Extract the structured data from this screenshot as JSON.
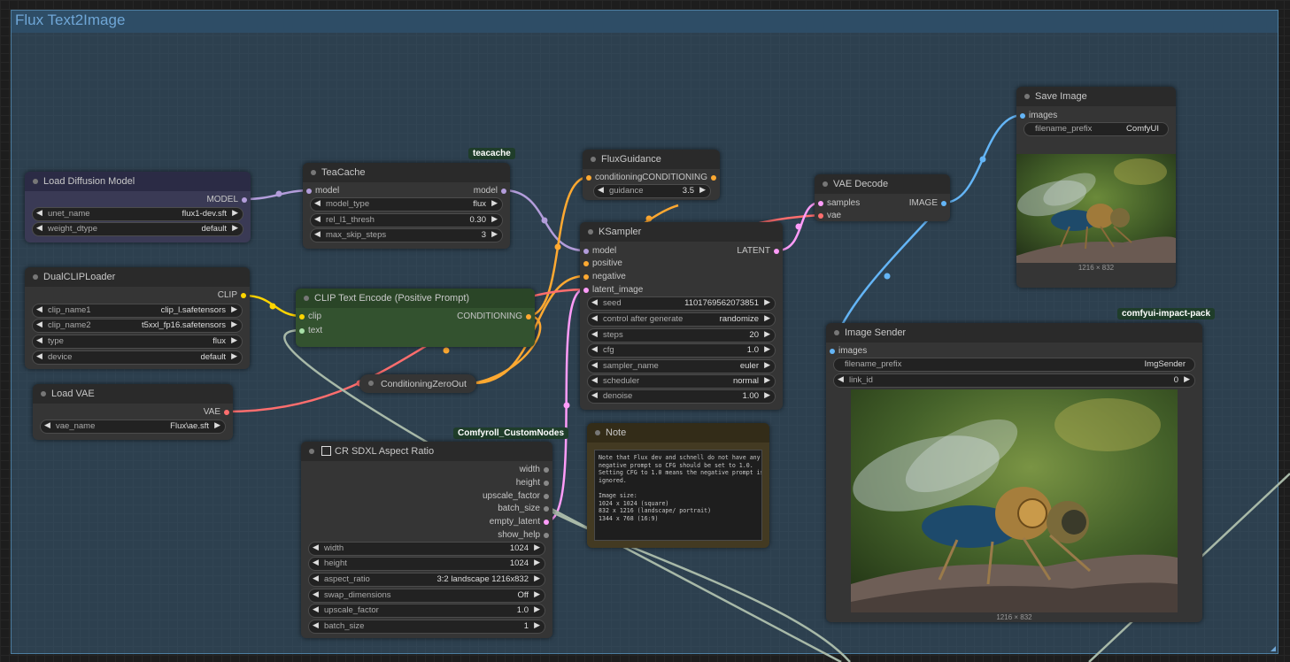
{
  "group": {
    "title": "Flux Text2Image"
  },
  "colors": {
    "model": "#b39ddb",
    "clip": "#ffd500",
    "conditioning": "#ffa931",
    "latent": "#ff9cf9",
    "vae": "#ff6e6e",
    "image": "#64b5f6",
    "text": "#a8b9a8"
  },
  "badges": {
    "teacache": "teacache",
    "comfyroll": "Comfyroll_CustomNodes",
    "impact": "comfyui-impact-pack"
  },
  "load_diffusion": {
    "title": "Load Diffusion Model",
    "out_model": "MODEL",
    "unet_name_label": "unet_name",
    "unet_name": "flux1-dev.sft",
    "weight_dtype_label": "weight_dtype",
    "weight_dtype": "default"
  },
  "dualclip": {
    "title": "DualCLIPLoader",
    "out_clip": "CLIP",
    "clip_name1_label": "clip_name1",
    "clip_name1": "clip_l.safetensors",
    "clip_name2_label": "clip_name2",
    "clip_name2": "t5xxl_fp16.safetensors",
    "type_label": "type",
    "type": "flux",
    "device_label": "device",
    "device": "default"
  },
  "load_vae": {
    "title": "Load VAE",
    "out_vae": "VAE",
    "vae_name_label": "vae_name",
    "vae_name": "Flux\\ae.sft"
  },
  "teacache": {
    "title": "TeaCache",
    "in_model": "model",
    "out_model": "model",
    "model_type_label": "model_type",
    "model_type": "flux",
    "rel_l1_thresh_label": "rel_l1_thresh",
    "rel_l1_thresh": "0.30",
    "max_skip_steps_label": "max_skip_steps",
    "max_skip_steps": "3"
  },
  "clip_encode": {
    "title": "CLIP Text Encode (Positive Prompt)",
    "in_clip": "clip",
    "in_text": "text",
    "out_conditioning": "CONDITIONING"
  },
  "cond_zero": {
    "title": "ConditioningZeroOut"
  },
  "flux_guidance": {
    "title": "FluxGuidance",
    "in_conditioning": "conditioning",
    "out_conditioning": "CONDITIONING",
    "guidance_label": "guidance",
    "guidance": "3.5"
  },
  "ksampler": {
    "title": "KSampler",
    "in_model": "model",
    "in_positive": "positive",
    "in_negative": "negative",
    "in_latent": "latent_image",
    "out_latent": "LATENT",
    "seed_label": "seed",
    "seed": "1101769562073851",
    "control_label": "control after generate",
    "control": "randomize",
    "steps_label": "steps",
    "steps": "20",
    "cfg_label": "cfg",
    "cfg": "1.0",
    "sampler_label": "sampler_name",
    "sampler": "euler",
    "scheduler_label": "scheduler",
    "scheduler": "normal",
    "denoise_label": "denoise",
    "denoise": "1.00"
  },
  "vae_decode": {
    "title": "VAE Decode",
    "in_samples": "samples",
    "in_vae": "vae",
    "out_image": "IMAGE"
  },
  "save_image": {
    "title": "Save Image",
    "in_images": "images",
    "filename_prefix_label": "filename_prefix",
    "filename_prefix": "ComfyUI",
    "size": "1216 × 832"
  },
  "image_sender": {
    "title": "Image Sender",
    "in_images": "images",
    "filename_prefix_label": "filename_prefix",
    "filename_prefix": "ImgSender",
    "link_id_label": "link_id",
    "link_id": "0",
    "size": "1216 × 832"
  },
  "note": {
    "title": "Note",
    "text": "Note that Flux dev and schnell do not have any\nnegative prompt so CFG should be set to 1.0.\nSetting CFG to 1.0 means the negative prompt is\nignored.\n\nImage size:\n1024 x 1024 (square)\n832 x 1216 (landscape/ portrait)\n1344 x 768 (16:9)"
  },
  "cr_sdxl": {
    "title": "CR SDXL Aspect Ratio",
    "out_width": "width",
    "out_height": "height",
    "out_upscale": "upscale_factor",
    "out_batch": "batch_size",
    "out_latent": "empty_latent",
    "out_help": "show_help",
    "width_label": "width",
    "width": "1024",
    "height_label": "height",
    "height": "1024",
    "aspect_label": "aspect_ratio",
    "aspect": "3:2 landscape 1216x832",
    "swap_label": "swap_dimensions",
    "swap": "Off",
    "upscale_label": "upscale_factor",
    "upscale": "1.0",
    "batch_label": "batch_size",
    "batch": "1"
  }
}
